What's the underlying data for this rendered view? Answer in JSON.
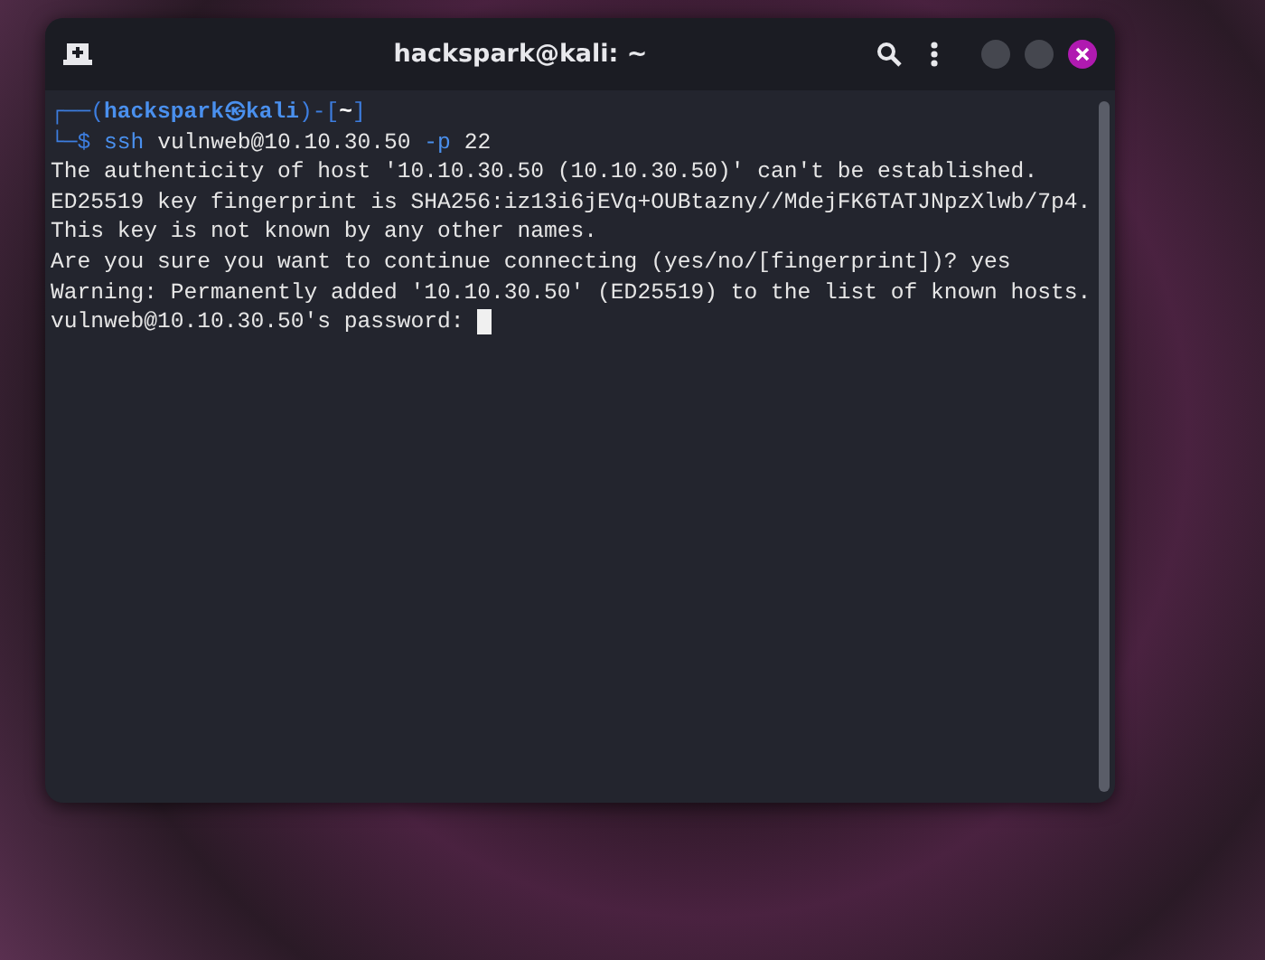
{
  "window": {
    "title": "hackspark@kali: ~"
  },
  "terminal": {
    "prompt_lines": [
      {
        "spaced": false,
        "tokens": [
          {
            "text": "┌──(",
            "kind": "frame"
          },
          {
            "text": "hackspark㉿kali",
            "kind": "userhost"
          },
          {
            "text": ")-[",
            "kind": "frame"
          },
          {
            "text": "~",
            "kind": "dir"
          },
          {
            "text": "]",
            "kind": "frame"
          }
        ]
      },
      {
        "spaced": true,
        "tokens": [
          {
            "text": "└─$",
            "kind": "frame"
          },
          {
            "text": "ssh",
            "kind": "command"
          },
          {
            "text": "vulnweb@10.10.30.50",
            "kind": "arg"
          },
          {
            "text": "-p",
            "kind": "option"
          },
          {
            "text": "22",
            "kind": "arg"
          }
        ]
      }
    ],
    "output": [
      "The authenticity of host '10.10.30.50 (10.10.30.50)' can't be established.",
      "ED25519 key fingerprint is SHA256:iz13i6jEVq+OUBtazny//MdejFK6TATJNpzXlwb/7p4.",
      "This key is not known by any other names.",
      "Are you sure you want to continue connecting (yes/no/[fingerprint])? yes",
      "Warning: Permanently added '10.10.30.50' (ED25519) to the list of known hosts.",
      "vulnweb@10.10.30.50's password:"
    ],
    "cursor": true
  }
}
